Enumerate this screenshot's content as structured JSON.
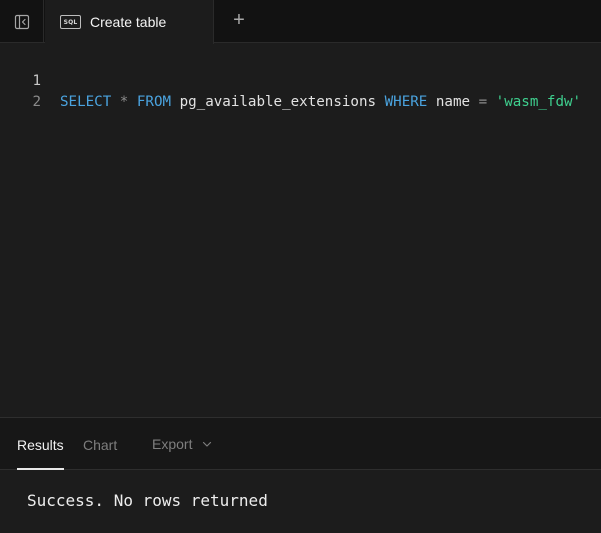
{
  "tab_bar": {
    "sidebar_toggle_icon": "sidebar-collapse-icon",
    "active_tab": {
      "badge": "SQL",
      "label": "Create table"
    },
    "new_tab_icon": "plus-icon",
    "new_tab_glyph": "+"
  },
  "editor": {
    "lines": [
      {
        "number": "1",
        "tokens": [
          {
            "text": "SELECT",
            "kind": "keyword"
          },
          {
            "text": " ",
            "kind": "plain"
          },
          {
            "text": "*",
            "kind": "operator"
          },
          {
            "text": " ",
            "kind": "plain"
          },
          {
            "text": "FROM",
            "kind": "keyword"
          },
          {
            "text": " pg_available_extensions ",
            "kind": "plain"
          },
          {
            "text": "WHERE",
            "kind": "keyword"
          },
          {
            "text": " name ",
            "kind": "plain"
          },
          {
            "text": "=",
            "kind": "operator"
          },
          {
            "text": " ",
            "kind": "plain"
          },
          {
            "text": "'wasm_fdw'",
            "kind": "string"
          }
        ]
      },
      {
        "number": "2",
        "tokens": []
      }
    ]
  },
  "results": {
    "tabs": [
      {
        "label": "Results",
        "active": true
      },
      {
        "label": "Chart",
        "active": false
      },
      {
        "label": "Export",
        "active": false,
        "has_dropdown": true
      }
    ],
    "status": "Success. No rows returned"
  },
  "colors": {
    "background": "#1c1c1c",
    "tabbar_background": "#121212",
    "keyword": "#4aa3df",
    "string": "#3ecf8e",
    "operator": "#8c8c8c"
  }
}
